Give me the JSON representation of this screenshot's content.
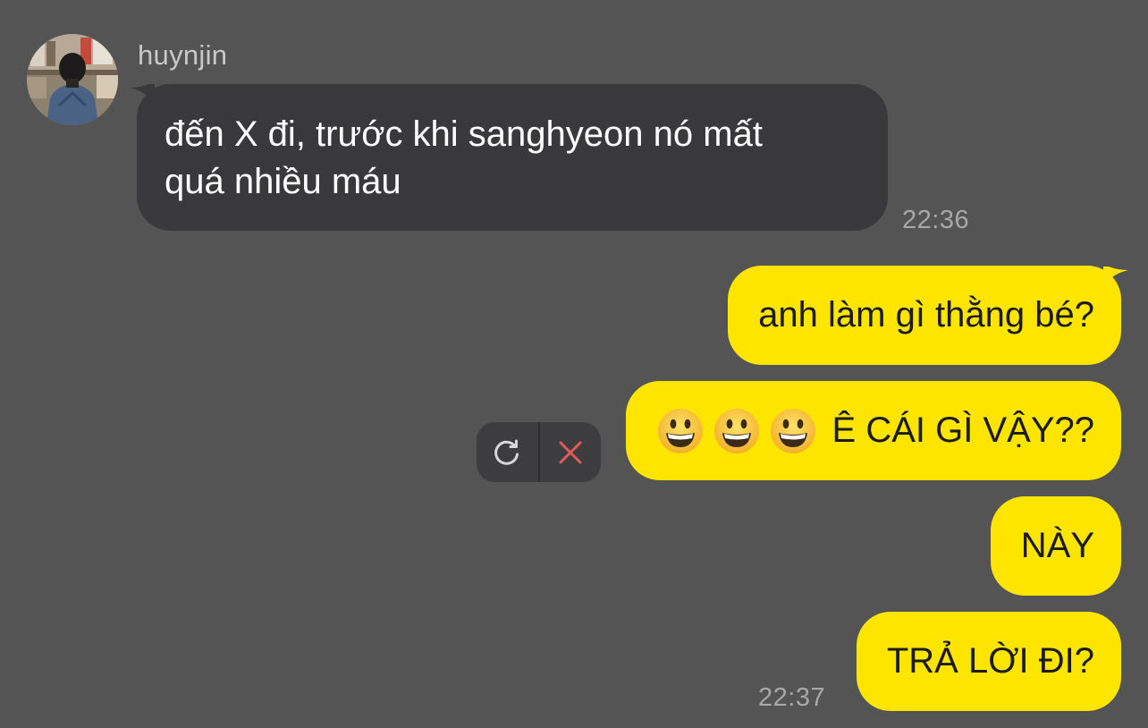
{
  "incoming": {
    "sender_name": "huynjin",
    "message_line1": "đến X đi, trước khi sanghyeon nó mất",
    "message_line2": "quá nhiều máu",
    "time": "22:36",
    "bubble_color": "#39383a"
  },
  "outgoing": {
    "bubble_color": "#fee500",
    "messages": [
      {
        "text": "anh làm gì thằng bé?"
      },
      {
        "text": "Ê CÁI GÌ VẬY??",
        "emojis": [
          "grinning-face",
          "grinning-face",
          "grinning-face"
        ],
        "failed": true
      },
      {
        "text": "NÀY"
      },
      {
        "text": "TRẢ LỜI ĐI?"
      }
    ],
    "time": "22:37"
  },
  "failed_actions": {
    "retry_icon": "refresh-icon",
    "delete_icon": "close-icon",
    "delete_color": "#e05a5a"
  },
  "theme": {
    "background": "#555455"
  }
}
